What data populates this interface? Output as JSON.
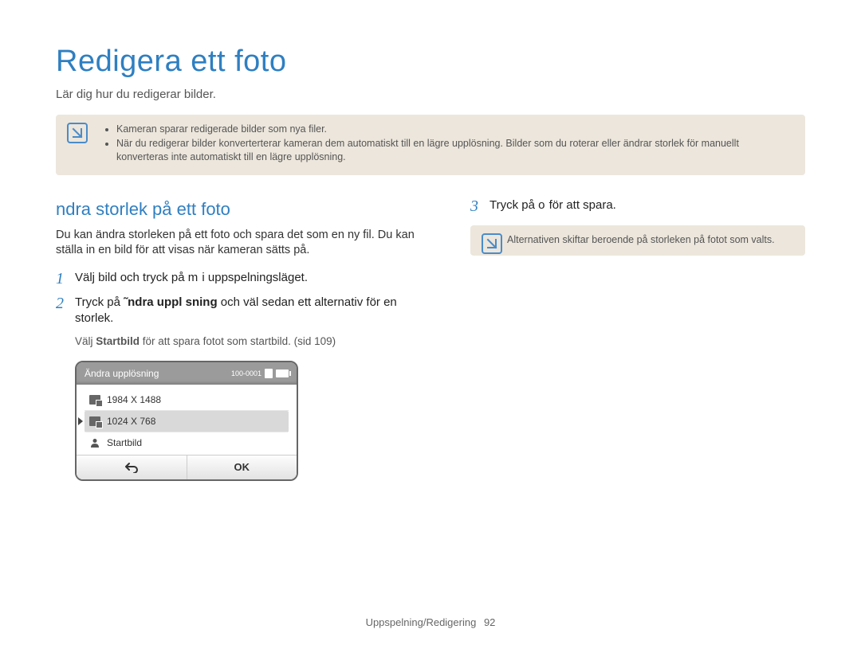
{
  "title": "Redigera ett foto",
  "subtitle": "Lär dig hur du redigerar bilder.",
  "top_note": {
    "items": [
      "Kameran sparar redigerade bilder som nya filer.",
      "När du redigerar bilder konverterterar kameran dem automatiskt till en lägre upplösning. Bilder som du roterar eller ändrar storlek för manuellt konverteras inte automatiskt till en lägre upplösning."
    ]
  },
  "left": {
    "heading": "ndra storlek på ett foto",
    "intro": "Du kan ändra storleken på ett foto och spara det som en ny fil. Du kan ställa in en bild för att visas när kameran sätts på.",
    "step1": {
      "num": "1",
      "pre": "Välj bild och tryck på ",
      "key": "m",
      "post": " i uppspelningsläget."
    },
    "step2": {
      "num": "2",
      "pre": "Tryck på ",
      "bold": "˜ndra uppl sning",
      "post": " och väl sedan ett alternativ för en storlek.",
      "note_pre": "Välj ",
      "note_bold": "Startbild",
      "note_post": " för att spara fotot som startbild. (sid 109)"
    },
    "camera": {
      "header": "Ändra upplösning",
      "counter": "100-0001",
      "items": [
        {
          "label": "1984 X 1488",
          "selected": false
        },
        {
          "label": "1024 X 768",
          "selected": true
        },
        {
          "label": "Startbild",
          "selected": false,
          "user": true
        }
      ],
      "ok": "OK"
    }
  },
  "right": {
    "step3": {
      "num": "3",
      "pre": "Tryck på ",
      "key": "o",
      "post": " för att spara."
    },
    "note": "Alternativen skiftar beroende på storleken på fotot som valts."
  },
  "footer": {
    "section": "Uppspelning/Redigering",
    "page": "92"
  }
}
